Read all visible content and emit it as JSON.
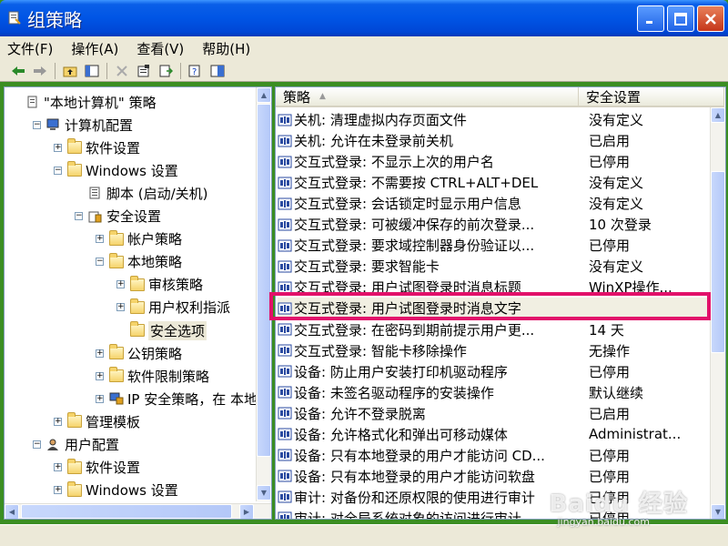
{
  "window": {
    "title": "组策略",
    "icon": "gpedit-icon"
  },
  "menu": [
    {
      "label": "文件(F)"
    },
    {
      "label": "操作(A)"
    },
    {
      "label": "查看(V)"
    },
    {
      "label": "帮助(H)"
    }
  ],
  "tree": [
    {
      "label": "\"本地计算机\" 策略",
      "icon": "policy-icon",
      "expander": ""
    },
    {
      "label": "计算机配置",
      "icon": "computer-icon",
      "expander": "−"
    },
    {
      "label": "软件设置",
      "icon": "folder-icon",
      "expander": "+"
    },
    {
      "label": "Windows 设置",
      "icon": "folder-icon",
      "expander": "−"
    },
    {
      "label": "脚本 (启动/关机)",
      "icon": "script-icon",
      "expander": ""
    },
    {
      "label": "安全设置",
      "icon": "security-icon",
      "expander": "−"
    },
    {
      "label": "帐户策略",
      "icon": "folder-icon",
      "expander": "+"
    },
    {
      "label": "本地策略",
      "icon": "folder-icon",
      "expander": "−"
    },
    {
      "label": "审核策略",
      "icon": "folder-icon",
      "expander": "+"
    },
    {
      "label": "用户权利指派",
      "icon": "folder-icon",
      "expander": "+"
    },
    {
      "label": "安全选项",
      "icon": "folder-icon",
      "expander": ""
    },
    {
      "label": "公钥策略",
      "icon": "folder-icon",
      "expander": "+"
    },
    {
      "label": "软件限制策略",
      "icon": "folder-icon",
      "expander": "+"
    },
    {
      "label": "IP 安全策略，在 本地",
      "icon": "ip-security-icon",
      "expander": "+"
    },
    {
      "label": "管理模板",
      "icon": "folder-icon",
      "expander": "+"
    },
    {
      "label": "用户配置",
      "icon": "user-icon",
      "expander": "−"
    },
    {
      "label": "软件设置",
      "icon": "folder-icon",
      "expander": "+"
    },
    {
      "label": "Windows 设置",
      "icon": "folder-icon",
      "expander": "+"
    }
  ],
  "columns": {
    "policy": "策略",
    "setting": "安全设置"
  },
  "policies": [
    {
      "name": "关机: 清理虚拟内存页面文件",
      "setting": "没有定义"
    },
    {
      "name": "关机: 允许在未登录前关机",
      "setting": "已启用"
    },
    {
      "name": "交互式登录: 不显示上次的用户名",
      "setting": "已停用"
    },
    {
      "name": "交互式登录: 不需要按 CTRL+ALT+DEL",
      "setting": "没有定义"
    },
    {
      "name": "交互式登录: 会话锁定时显示用户信息",
      "setting": "没有定义"
    },
    {
      "name": "交互式登录: 可被缓冲保存的前次登录...",
      "setting": "10 次登录"
    },
    {
      "name": "交互式登录: 要求域控制器身份验证以...",
      "setting": "已停用"
    },
    {
      "name": "交互式登录: 要求智能卡",
      "setting": "没有定义"
    },
    {
      "name": "交互式登录: 用户试图登录时消息标题",
      "setting": "WinXP操作..."
    },
    {
      "name": "交互式登录: 用户试图登录时消息文字",
      "setting": ""
    },
    {
      "name": "交互式登录: 在密码到期前提示用户更...",
      "setting": "14 天"
    },
    {
      "name": "交互式登录: 智能卡移除操作",
      "setting": "无操作"
    },
    {
      "name": "设备: 防止用户安装打印机驱动程序",
      "setting": "已停用"
    },
    {
      "name": "设备: 未签名驱动程序的安装操作",
      "setting": "默认继续"
    },
    {
      "name": "设备: 允许不登录脱离",
      "setting": "已启用"
    },
    {
      "name": "设备: 允许格式化和弹出可移动媒体",
      "setting": "Administrat..."
    },
    {
      "name": "设备: 只有本地登录的用户才能访问 CD...",
      "setting": "已停用"
    },
    {
      "name": "设备: 只有本地登录的用户才能访问软盘",
      "setting": "已停用"
    },
    {
      "name": "审计: 对备份和还原权限的使用进行审计",
      "setting": "已停用"
    },
    {
      "name": "审计: 对全局系统对象的访问进行审计",
      "setting": "已停用"
    }
  ],
  "highlight_color": "#e2116a",
  "watermark": {
    "main": "Baidu 经验",
    "sub": "jingyan.baidu.com"
  }
}
